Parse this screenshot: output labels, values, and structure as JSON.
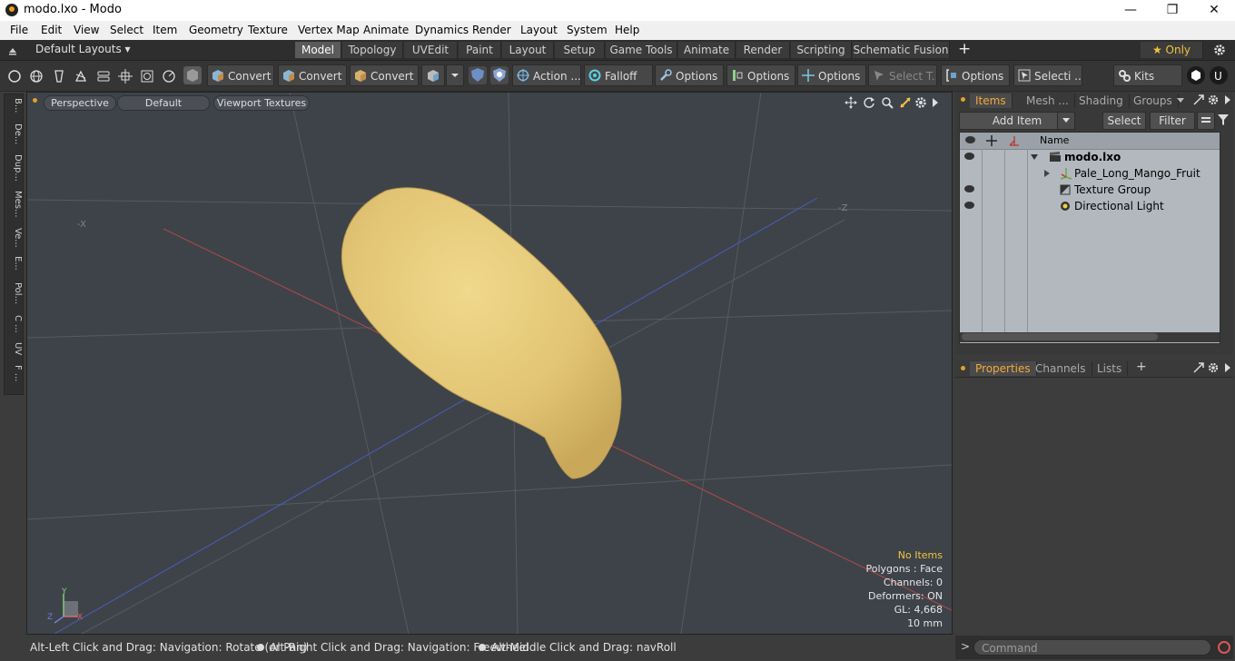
{
  "window": {
    "title": "modo.lxo - Modo",
    "minimize": "—",
    "restore": "❐",
    "close": "✕"
  },
  "menu": [
    "File",
    "Edit",
    "View",
    "Select",
    "Item",
    "Geometry",
    "Texture",
    "Vertex Map",
    "Animate",
    "Dynamics",
    "Render",
    "Layout",
    "System",
    "Help"
  ],
  "layouts": {
    "selector": "Default Layouts ▾",
    "tabs": [
      "Model",
      "Topology",
      "UVEdit",
      "Paint",
      "Layout",
      "Setup",
      "Game Tools",
      "Animate",
      "Render",
      "Scripting",
      "Schematic Fusion"
    ],
    "active": "Model",
    "add": "+",
    "only_label": "★  Only"
  },
  "toolbar": {
    "convert1": "Convert",
    "convert2": "Convert",
    "convert3": "Convert",
    "action": "Action ...",
    "falloff": "Falloff",
    "options1": "Options",
    "options2": "Options",
    "options3": "Options",
    "select_t": "Select T...",
    "options4": "Options",
    "selecti": "Selecti ...",
    "kits": "Kits"
  },
  "left_tabs": [
    "B...",
    "De...",
    "Dup...",
    "Mes...",
    "Ve...",
    "E...",
    "Pol...",
    "C ...",
    "UV",
    "F ..."
  ],
  "viewport": {
    "perspective": "Perspective",
    "default": "Default",
    "textures": "Viewport Textures",
    "hud": {
      "no_items": "No Items",
      "polygons": "Polygons : Face",
      "channels": "Channels: 0",
      "deformers": "Deformers: ON",
      "gl": "GL: 4,668",
      "scale": "10 mm"
    },
    "axis_x_neg": "-X",
    "axis_z_neg": "-Z",
    "gizmo_y": "Y",
    "gizmo_z": "Z",
    "gizmo_x": "X"
  },
  "status": {
    "hint1": "Alt-Left Click and Drag: Navigation: Rotate (or Pan)",
    "hint2": "Alt-Right Click and Drag: Navigation: Freewheel",
    "hint3": "Alt-Middle Click and Drag: navRoll"
  },
  "items_panel": {
    "tabs": [
      "Items",
      "Mesh ...",
      "Shading",
      "Groups"
    ],
    "active": "Items",
    "add_item": "Add Item",
    "select": "Select",
    "filter": "Filter",
    "col_name": "Name",
    "rows": [
      {
        "name": "modo.lxo",
        "bold": true
      },
      {
        "name": "Pale_Long_Mango_Fruit"
      },
      {
        "name": "Texture Group"
      },
      {
        "name": "Directional Light"
      }
    ]
  },
  "props_panel": {
    "tabs": [
      "Properties",
      "Channels",
      "Lists"
    ],
    "active": "Properties",
    "add": "+"
  },
  "command": {
    "placeholder": "Command",
    "prompt": ">"
  },
  "colors": {
    "accent": "#f2a93b",
    "viewport_bg": "#3e4349",
    "mango": "#e2c574"
  }
}
